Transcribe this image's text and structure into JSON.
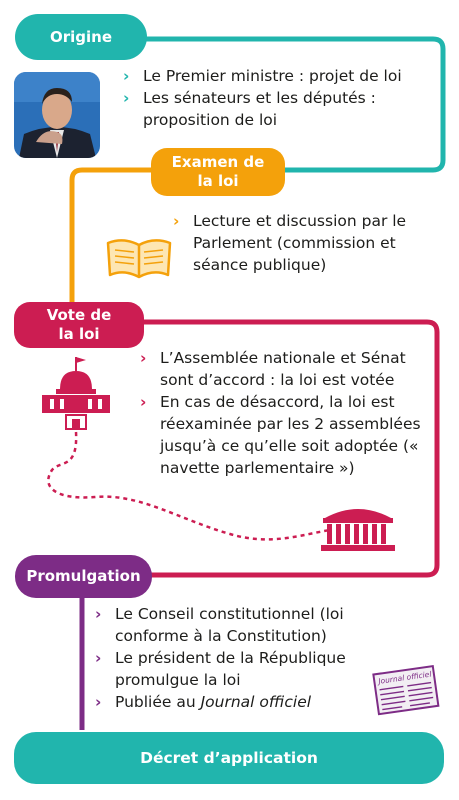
{
  "colors": {
    "teal": "#21b5ad",
    "orange": "#f4a10b",
    "crimson": "#cc1d52",
    "purple": "#7d2c86"
  },
  "steps": {
    "origine": {
      "title": "Origine",
      "items": [
        "Le Premier ministre : projet de loi",
        "Les sénateurs et les députés : proposition de loi"
      ]
    },
    "examen": {
      "title_l1": "Examen de",
      "title_l2": "la loi",
      "items": [
        "Lecture et discussion par le Parlement (commission et séance publique)"
      ]
    },
    "vote": {
      "title_l1": "Vote de",
      "title_l2": "la loi",
      "items": [
        "L’Assemblée nationale et Sénat sont d’accord : la loi est votée",
        "En cas de désaccord, la loi est réexaminée par les 2 assemblées jusqu’à ce qu’elle soit adoptée (« navette parlementaire »)"
      ]
    },
    "promulgation": {
      "title": "Promulgation",
      "items": [
        "Le Conseil constitutionnel (loi conforme à la Constitution)",
        "Le président de la République promulgue la loi",
        "Publiée au "
      ],
      "item3_italic": "Journal officiel"
    },
    "decret": {
      "title": "Décret d’application"
    }
  },
  "newspaper_label": "Journal officiel",
  "chevron": "›",
  "icons": [
    "minister-photo",
    "book-icon",
    "assemblee-building-icon",
    "senat-building-icon",
    "newspaper-icon"
  ]
}
